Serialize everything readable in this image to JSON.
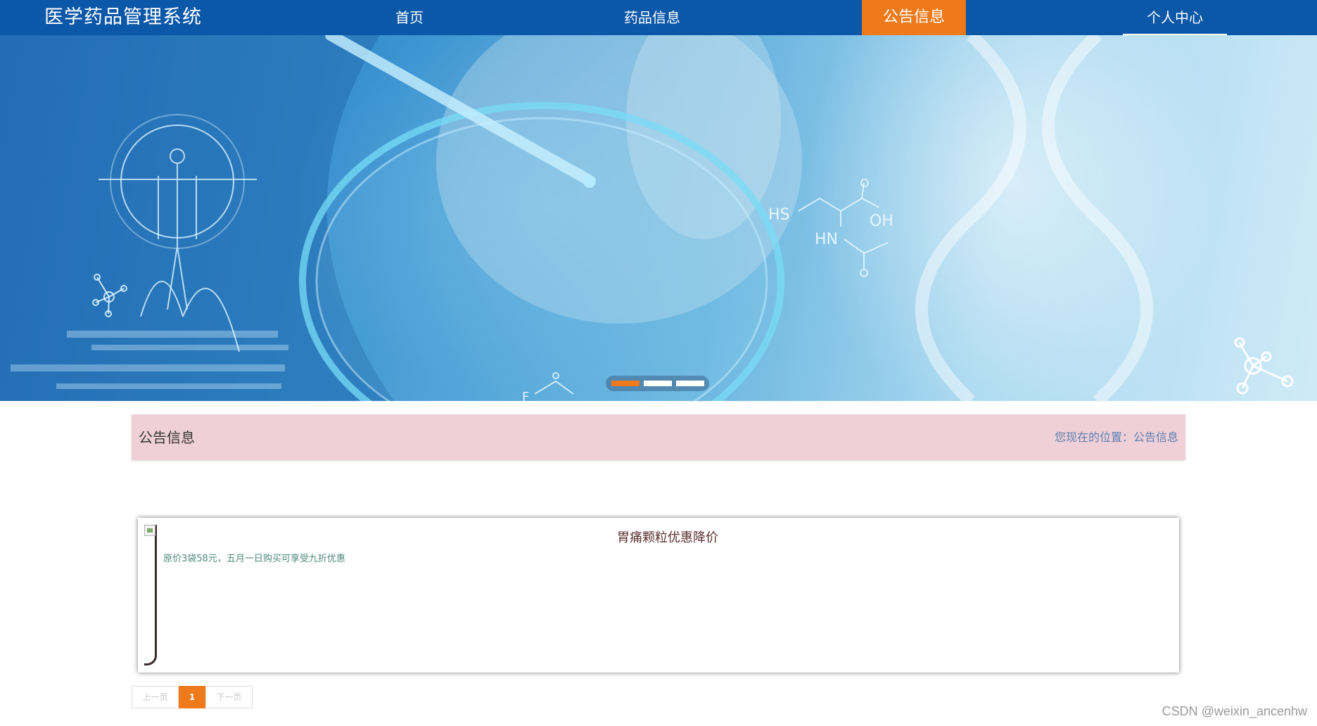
{
  "header": {
    "brand": "医学药品管理系统",
    "nav": [
      {
        "label": "首页",
        "active": false
      },
      {
        "label": "药品信息",
        "active": false
      },
      {
        "label": "公告信息",
        "active": true
      },
      {
        "label": "个人中心",
        "active": false
      }
    ]
  },
  "banner": {
    "chem_labels": [
      "HS",
      "OH",
      "HN",
      "F"
    ],
    "slides": 3,
    "active_slide": 0
  },
  "breadcrumb": {
    "title": "公告信息",
    "location": "您现在的位置：公告信息"
  },
  "notices": [
    {
      "title": "胃痛颗粒优惠降价",
      "desc": "原价3袋58元，五月一日购买可享受九折优惠"
    }
  ],
  "pager": {
    "prev": "上一页",
    "page": "1",
    "next": "下一页"
  },
  "watermark": "CSDN @weixin_ancenhw",
  "colors": {
    "nav_bg": "#0b57a8",
    "accent": "#ee7a1b",
    "crumb_bg": "#efd0d8"
  }
}
